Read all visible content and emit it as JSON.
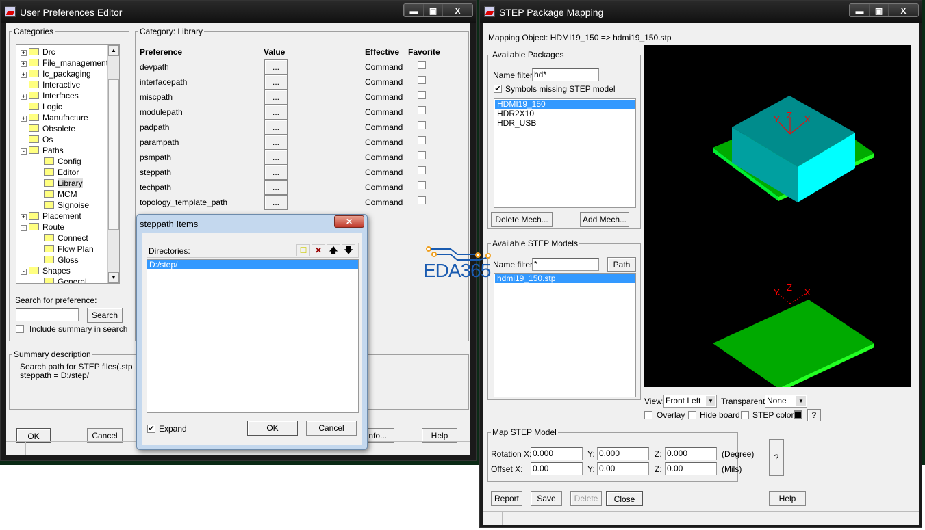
{
  "prefs_window": {
    "title": "User Preferences Editor",
    "categories_label": "Categories",
    "tree": [
      {
        "label": "Drc",
        "lvl": 0,
        "exp": "+"
      },
      {
        "label": "File_management",
        "lvl": 0,
        "exp": "+"
      },
      {
        "label": "Ic_packaging",
        "lvl": 0,
        "exp": "+"
      },
      {
        "label": "Interactive",
        "lvl": 0,
        "exp": ""
      },
      {
        "label": "Interfaces",
        "lvl": 0,
        "exp": "+"
      },
      {
        "label": "Logic",
        "lvl": 0,
        "exp": ""
      },
      {
        "label": "Manufacture",
        "lvl": 0,
        "exp": "+"
      },
      {
        "label": "Obsolete",
        "lvl": 0,
        "exp": ""
      },
      {
        "label": "Os",
        "lvl": 0,
        "exp": ""
      },
      {
        "label": "Paths",
        "lvl": 0,
        "exp": "-"
      },
      {
        "label": "Config",
        "lvl": 1,
        "exp": ""
      },
      {
        "label": "Editor",
        "lvl": 1,
        "exp": ""
      },
      {
        "label": "Library",
        "lvl": 1,
        "exp": "",
        "selected": true
      },
      {
        "label": "MCM",
        "lvl": 1,
        "exp": ""
      },
      {
        "label": "Signoise",
        "lvl": 1,
        "exp": ""
      },
      {
        "label": "Placement",
        "lvl": 0,
        "exp": "+"
      },
      {
        "label": "Route",
        "lvl": 0,
        "exp": "-"
      },
      {
        "label": "Connect",
        "lvl": 1,
        "exp": ""
      },
      {
        "label": "Flow Plan",
        "lvl": 1,
        "exp": ""
      },
      {
        "label": "Gloss",
        "lvl": 1,
        "exp": ""
      },
      {
        "label": "Shapes",
        "lvl": 0,
        "exp": "-"
      },
      {
        "label": "General",
        "lvl": 1,
        "exp": ""
      }
    ],
    "category_label": "Category:  Library",
    "headers": {
      "preference": "Preference",
      "value": "Value",
      "effective": "Effective",
      "favorite": "Favorite"
    },
    "rows": [
      {
        "name": "devpath",
        "value": "...",
        "effective": "Command"
      },
      {
        "name": "interfacepath",
        "value": "...",
        "effective": "Command"
      },
      {
        "name": "miscpath",
        "value": "...",
        "effective": "Command"
      },
      {
        "name": "modulepath",
        "value": "...",
        "effective": "Command"
      },
      {
        "name": "padpath",
        "value": "...",
        "effective": "Command"
      },
      {
        "name": "parampath",
        "value": "...",
        "effective": "Command"
      },
      {
        "name": "psmpath",
        "value": "...",
        "effective": "Command"
      },
      {
        "name": "steppath",
        "value": "...",
        "effective": "Command"
      },
      {
        "name": "techpath",
        "value": "...",
        "effective": "Command"
      },
      {
        "name": "topology_template_path",
        "value": "...",
        "effective": "Command"
      }
    ],
    "search_label": "Search for preference:",
    "search_value": "",
    "search_button": "Search",
    "include_summary": "Include summary in search",
    "summary_label": "Summary description",
    "summary_line1": "Search path for STEP files(.stp .step",
    "summary_line2": "steppath = D:/step/",
    "ok": "OK",
    "cancel": "Cancel",
    "info": "Info...",
    "help": "Help"
  },
  "steppath_dialog": {
    "title": "steppath Items",
    "directories_label": "Directories:",
    "items": [
      "D:/step/"
    ],
    "expand": "Expand",
    "ok": "OK",
    "cancel": "Cancel"
  },
  "watermark": "EDA365",
  "step_window": {
    "title": "STEP Package Mapping",
    "mapping_object": "Mapping Object:  HDMI19_150 => hdmi19_150.stp",
    "available_packages": "Available Packages",
    "name_filter_label": "Name filter:",
    "pkg_filter": "hd*",
    "symbols_missing": "Symbols missing STEP model",
    "packages": [
      "HDMI19_150",
      "HDR2X10",
      "HDR_USB"
    ],
    "delete_mech": "Delete Mech...",
    "add_mech": "Add Mech...",
    "available_models": "Available STEP Models",
    "model_filter": "*",
    "path_button": "Path",
    "models": [
      "hdmi19_150.stp"
    ],
    "view_label": "View:",
    "view_value": "Front Left",
    "transparent_label": "Transparent:",
    "transparent_value": "None",
    "overlay": "Overlay",
    "hide_board": "Hide board",
    "step_color": "STEP color",
    "q": "?",
    "map_model": "Map STEP Model",
    "rotation_label": "Rotation X:",
    "offset_label": "Offset X:",
    "y_label": "Y:",
    "z_label": "Z:",
    "rot": [
      "0.000",
      "0.000",
      "0.000"
    ],
    "off": [
      "0.00",
      "0.00",
      "0.00"
    ],
    "degree": "(Degree)",
    "mils": "(Mils)",
    "report": "Report",
    "save": "Save",
    "delete": "Delete",
    "close": "Close",
    "help": "Help",
    "axes": [
      "Y",
      "Z",
      "X"
    ]
  }
}
